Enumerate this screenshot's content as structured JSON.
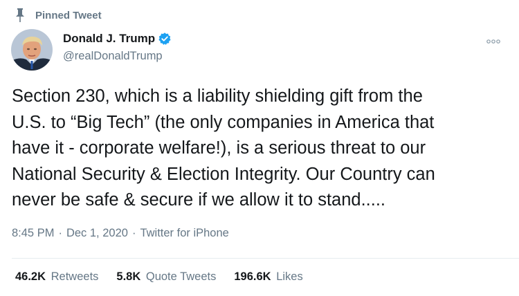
{
  "pinned_label": "Pinned Tweet",
  "author": {
    "name": "Donald J. Trump",
    "handle": "@realDonaldTrump",
    "verified": true
  },
  "tweet": {
    "text": "Section 230, which is a liability shielding gift from the\nU.S. to “Big Tech” (the only companies in America that\nhave it - corporate welfare!), is a serious threat to our\nNational Security & Election Integrity. Our Country can\nnever be safe & secure if we allow it to stand.....",
    "time": "8:45 PM",
    "date": "Dec 1, 2020",
    "source": "Twitter for iPhone",
    "separator": "·"
  },
  "stats": {
    "retweets": {
      "count": "46.2K",
      "label": "Retweets"
    },
    "quote_tweets": {
      "count": "5.8K",
      "label": "Quote Tweets"
    },
    "likes": {
      "count": "196.6K",
      "label": "Likes"
    }
  },
  "colors": {
    "text": "#14171a",
    "secondary": "#657786",
    "verified": "#1da1f2",
    "divider": "#e6ecf0"
  },
  "icons": [
    "pin-icon",
    "verified-icon",
    "more-icon"
  ]
}
